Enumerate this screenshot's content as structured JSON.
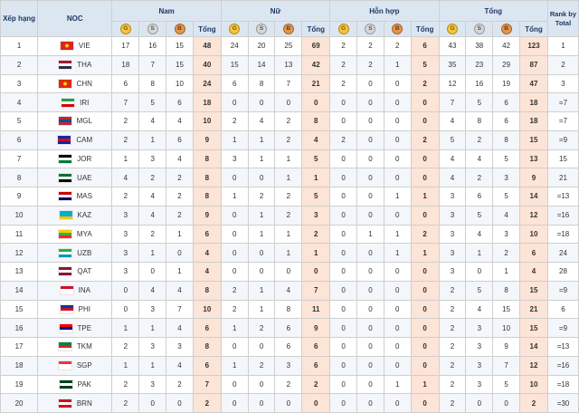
{
  "headers": {
    "rank": "Xếp hạng",
    "noc": "NOC",
    "groups": [
      "Nam",
      "Nữ",
      "Hỗn hợp",
      "Tổng"
    ],
    "total": "Tổng",
    "rank_by_total": "Rank by Total",
    "medal_letters": [
      "G",
      "S",
      "B"
    ]
  },
  "colors": {
    "header_bg": "#dce6f1",
    "total_col_bg": "#fce4d6",
    "gold": "#f4c542",
    "silver": "#d7d7d7",
    "bronze": "#e0984e"
  },
  "rows": [
    {
      "rank": "1",
      "noc": "VIE",
      "flag": [
        "#da251d",
        "#ffcd00",
        "star"
      ],
      "m": [
        "17",
        "16",
        "15",
        "48"
      ],
      "w": [
        "24",
        "20",
        "25",
        "69"
      ],
      "x": [
        "2",
        "2",
        "2",
        "6"
      ],
      "t": [
        "43",
        "38",
        "42",
        "123"
      ],
      "rbt": "1"
    },
    {
      "rank": "2",
      "noc": "THA",
      "flag": [
        "#a51931",
        "#f4f5f8",
        "#2d2a4a"
      ],
      "m": [
        "18",
        "7",
        "15",
        "40"
      ],
      "w": [
        "15",
        "14",
        "13",
        "42"
      ],
      "x": [
        "2",
        "2",
        "1",
        "5"
      ],
      "t": [
        "35",
        "23",
        "29",
        "87"
      ],
      "rbt": "2"
    },
    {
      "rank": "3",
      "noc": "CHN",
      "flag": [
        "#de2910",
        "#ffde00",
        "star"
      ],
      "m": [
        "6",
        "8",
        "10",
        "24"
      ],
      "w": [
        "6",
        "8",
        "7",
        "21"
      ],
      "x": [
        "2",
        "0",
        "0",
        "2"
      ],
      "t": [
        "12",
        "16",
        "19",
        "47"
      ],
      "rbt": "3"
    },
    {
      "rank": "4",
      "noc": "IRI",
      "flag": [
        "#239f40",
        "#ffffff",
        "#da0000"
      ],
      "m": [
        "7",
        "5",
        "6",
        "18"
      ],
      "w": [
        "0",
        "0",
        "0",
        "0"
      ],
      "x": [
        "0",
        "0",
        "0",
        "0"
      ],
      "t": [
        "7",
        "5",
        "6",
        "18"
      ],
      "rbt": "=7"
    },
    {
      "rank": "5",
      "noc": "MGL",
      "flag": [
        "#c4272f",
        "#015197",
        "#c4272f"
      ],
      "m": [
        "2",
        "4",
        "4",
        "10"
      ],
      "w": [
        "2",
        "4",
        "2",
        "8"
      ],
      "x": [
        "0",
        "0",
        "0",
        "0"
      ],
      "t": [
        "4",
        "8",
        "6",
        "18"
      ],
      "rbt": "=7"
    },
    {
      "rank": "6",
      "noc": "CAM",
      "flag": [
        "#032ea1",
        "#e00025",
        "#032ea1"
      ],
      "m": [
        "2",
        "1",
        "6",
        "9"
      ],
      "w": [
        "1",
        "1",
        "2",
        "4"
      ],
      "x": [
        "2",
        "0",
        "0",
        "2"
      ],
      "t": [
        "5",
        "2",
        "8",
        "15"
      ],
      "rbt": "=9"
    },
    {
      "rank": "7",
      "noc": "JOR",
      "flag": [
        "#000000",
        "#ffffff",
        "#007a3d"
      ],
      "m": [
        "1",
        "3",
        "4",
        "8"
      ],
      "w": [
        "3",
        "1",
        "1",
        "5"
      ],
      "x": [
        "0",
        "0",
        "0",
        "0"
      ],
      "t": [
        "4",
        "4",
        "5",
        "13"
      ],
      "rbt": "15"
    },
    {
      "rank": "8",
      "noc": "UAE",
      "flag": [
        "#00732f",
        "#ffffff",
        "#000000"
      ],
      "m": [
        "4",
        "2",
        "2",
        "8"
      ],
      "w": [
        "0",
        "0",
        "1",
        "1"
      ],
      "x": [
        "0",
        "0",
        "0",
        "0"
      ],
      "t": [
        "4",
        "2",
        "3",
        "9"
      ],
      "rbt": "21"
    },
    {
      "rank": "9",
      "noc": "MAS",
      "flag": [
        "#cc0001",
        "#ffffff",
        "#010066"
      ],
      "m": [
        "2",
        "4",
        "2",
        "8"
      ],
      "w": [
        "1",
        "2",
        "2",
        "5"
      ],
      "x": [
        "0",
        "0",
        "1",
        "1"
      ],
      "t": [
        "3",
        "6",
        "5",
        "14"
      ],
      "rbt": "=13"
    },
    {
      "rank": "10",
      "noc": "KAZ",
      "flag": [
        "#00afca",
        "#00afca",
        "#fec50c"
      ],
      "m": [
        "3",
        "4",
        "2",
        "9"
      ],
      "w": [
        "0",
        "1",
        "2",
        "3"
      ],
      "x": [
        "0",
        "0",
        "0",
        "0"
      ],
      "t": [
        "3",
        "5",
        "4",
        "12"
      ],
      "rbt": "=16"
    },
    {
      "rank": "11",
      "noc": "MYA",
      "flag": [
        "#fecb00",
        "#34b233",
        "#ea2839"
      ],
      "m": [
        "3",
        "2",
        "1",
        "6"
      ],
      "w": [
        "0",
        "1",
        "1",
        "2"
      ],
      "x": [
        "0",
        "1",
        "1",
        "2"
      ],
      "t": [
        "3",
        "4",
        "3",
        "10"
      ],
      "rbt": "=18"
    },
    {
      "rank": "12",
      "noc": "UZB",
      "flag": [
        "#1eb53a",
        "#ffffff",
        "#0099b5"
      ],
      "m": [
        "3",
        "1",
        "0",
        "4"
      ],
      "w": [
        "0",
        "0",
        "1",
        "1"
      ],
      "x": [
        "0",
        "0",
        "1",
        "1"
      ],
      "t": [
        "3",
        "1",
        "2",
        "6"
      ],
      "rbt": "24"
    },
    {
      "rank": "13",
      "noc": "QAT",
      "flag": [
        "#8a1538",
        "#ffffff",
        "#8a1538"
      ],
      "m": [
        "3",
        "0",
        "1",
        "4"
      ],
      "w": [
        "0",
        "0",
        "0",
        "0"
      ],
      "x": [
        "0",
        "0",
        "0",
        "0"
      ],
      "t": [
        "3",
        "0",
        "1",
        "4"
      ],
      "rbt": "28"
    },
    {
      "rank": "14",
      "noc": "INA",
      "flag": [
        "#ce1126",
        "#ffffff",
        "#ffffff"
      ],
      "m": [
        "0",
        "4",
        "4",
        "8"
      ],
      "w": [
        "2",
        "1",
        "4",
        "7"
      ],
      "x": [
        "0",
        "0",
        "0",
        "0"
      ],
      "t": [
        "2",
        "5",
        "8",
        "15"
      ],
      "rbt": "=9"
    },
    {
      "rank": "15",
      "noc": "PHI",
      "flag": [
        "#0038a8",
        "#ce1126",
        "#ffffff"
      ],
      "m": [
        "0",
        "3",
        "7",
        "10"
      ],
      "w": [
        "2",
        "1",
        "8",
        "11"
      ],
      "x": [
        "0",
        "0",
        "0",
        "0"
      ],
      "t": [
        "2",
        "4",
        "15",
        "21"
      ],
      "rbt": "6"
    },
    {
      "rank": "16",
      "noc": "TPE",
      "flag": [
        "#fe0000",
        "#000095",
        "#ffffff"
      ],
      "m": [
        "1",
        "1",
        "4",
        "6"
      ],
      "w": [
        "1",
        "2",
        "6",
        "9"
      ],
      "x": [
        "0",
        "0",
        "0",
        "0"
      ],
      "t": [
        "2",
        "3",
        "10",
        "15"
      ],
      "rbt": "=9"
    },
    {
      "rank": "17",
      "noc": "TKM",
      "flag": [
        "#00843d",
        "#d22630",
        "#ffffff"
      ],
      "m": [
        "2",
        "3",
        "3",
        "8"
      ],
      "w": [
        "0",
        "0",
        "6",
        "6"
      ],
      "x": [
        "0",
        "0",
        "0",
        "0"
      ],
      "t": [
        "2",
        "3",
        "9",
        "14"
      ],
      "rbt": "=13"
    },
    {
      "rank": "18",
      "noc": "SGP",
      "flag": [
        "#ef3340",
        "#ffffff",
        "#ffffff"
      ],
      "m": [
        "1",
        "1",
        "4",
        "6"
      ],
      "w": [
        "1",
        "2",
        "3",
        "6"
      ],
      "x": [
        "0",
        "0",
        "0",
        "0"
      ],
      "t": [
        "2",
        "3",
        "7",
        "12"
      ],
      "rbt": "=16"
    },
    {
      "rank": "19",
      "noc": "PAK",
      "flag": [
        "#01411c",
        "#ffffff",
        "#01411c"
      ],
      "m": [
        "2",
        "3",
        "2",
        "7"
      ],
      "w": [
        "0",
        "0",
        "2",
        "2"
      ],
      "x": [
        "0",
        "0",
        "1",
        "1"
      ],
      "t": [
        "2",
        "3",
        "5",
        "10"
      ],
      "rbt": "=18"
    },
    {
      "rank": "20",
      "noc": "BRN",
      "flag": [
        "#ce1126",
        "#ffffff",
        "#ce1126"
      ],
      "m": [
        "2",
        "0",
        "0",
        "2"
      ],
      "w": [
        "0",
        "0",
        "0",
        "0"
      ],
      "x": [
        "0",
        "0",
        "0",
        "0"
      ],
      "t": [
        "2",
        "0",
        "0",
        "2"
      ],
      "rbt": "=30"
    }
  ]
}
